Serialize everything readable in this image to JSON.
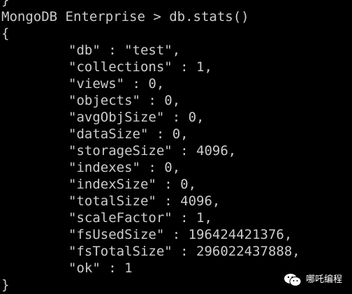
{
  "terminal": {
    "lines": {
      "fragment_top": "}",
      "prompt": "MongoDB Enterprise > db.stats()",
      "open_brace": "{",
      "close_brace": "}"
    },
    "fields": [
      "\"db\" : \"test\",",
      "\"collections\" : 1,",
      "\"views\" : 0,",
      "\"objects\" : 0,",
      "\"avgObjSize\" : 0,",
      "\"dataSize\" : 0,",
      "\"storageSize\" : 4096,",
      "\"indexes\" : 0,",
      "\"indexSize\" : 0,",
      "\"totalSize\" : 4096,",
      "\"scaleFactor\" : 1,",
      "\"fsUsedSize\" : 196424421376,",
      "\"fsTotalSize\" : 296022437888,",
      "\"ok\" : 1"
    ],
    "text_color": "#cccccc",
    "background_color": "#000000"
  },
  "watermark": {
    "label": "哪吒编程",
    "icon": "wechat-icon"
  }
}
